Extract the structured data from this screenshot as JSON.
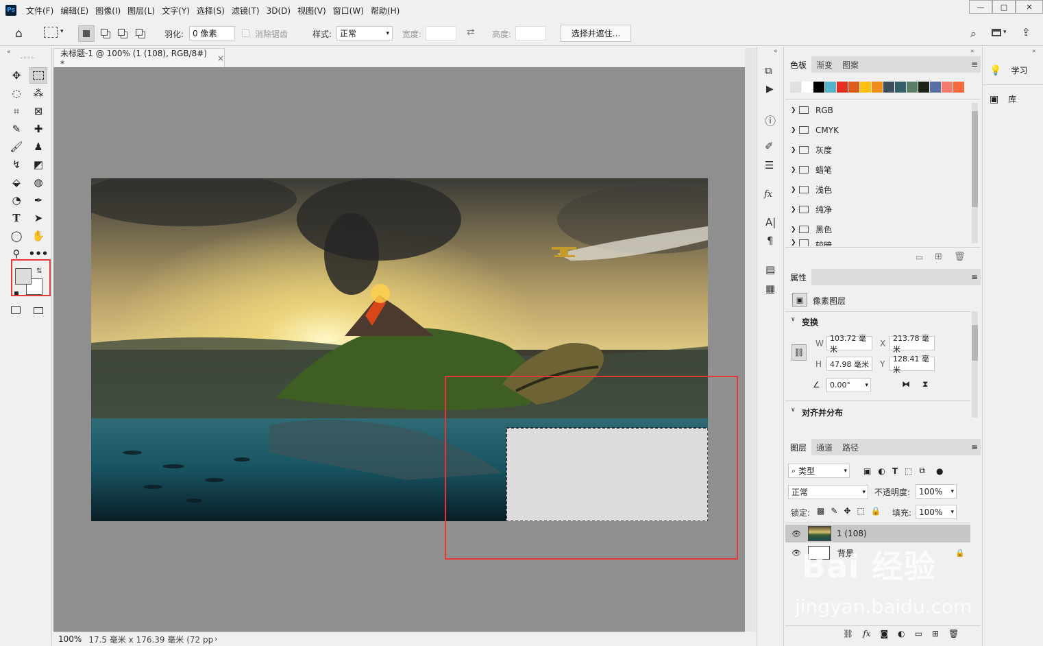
{
  "app_logo": "Ps",
  "menus": [
    "文件(F)",
    "编辑(E)",
    "图像(I)",
    "图层(L)",
    "文字(Y)",
    "选择(S)",
    "滤镜(T)",
    "3D(D)",
    "视图(V)",
    "窗口(W)",
    "帮助(H)"
  ],
  "window_controls": {
    "minimize": "—",
    "maximize": "□",
    "close": "✕"
  },
  "options": {
    "feather_label": "羽化:",
    "feather_value": "0 像素",
    "antialias_label": "消除锯齿",
    "style_label": "样式:",
    "style_value": "正常",
    "width_label": "宽度:",
    "height_label": "高度:",
    "select_mask_button": "选择并遮住..."
  },
  "document": {
    "tab_title": "未标题-1 @ 100% (1 (108), RGB/8#) *",
    "close": "×"
  },
  "status": {
    "zoom": "100%",
    "size": "17.5 毫米 x 176.39 毫米 (72 pp"
  },
  "swatches_panel": {
    "tabs": [
      "色板",
      "渐变",
      "图案"
    ],
    "colors": [
      "#e0e0e0",
      "#ffffff",
      "#000000",
      "#54b2c9",
      "#e6301f",
      "#d95e1b",
      "#fdc012",
      "#f08c1c",
      "#3f4e5c",
      "#345e6a",
      "#5b7e67",
      "#1a2419",
      "#5a6ea6",
      "#f07c6c",
      "#f46a3e"
    ],
    "folders": [
      "RGB",
      "CMYK",
      "灰度",
      "蜡笔",
      "浅色",
      "纯净",
      "黑色",
      "较暗"
    ]
  },
  "properties_panel": {
    "tab": "属性",
    "layer_type": "像素图层",
    "transform_title": "变换",
    "w_label": "W",
    "w_value": "103.72 毫米",
    "x_label": "X",
    "x_value": "213.78 毫米",
    "h_label": "H",
    "h_value": "47.98 毫米",
    "y_label": "Y",
    "y_value": "128.41 毫米",
    "angle_value": "0.00°",
    "align_title": "对齐并分布"
  },
  "layers_panel": {
    "tabs": [
      "图层",
      "通道",
      "路径"
    ],
    "filter_label": "类型",
    "blend_mode": "正常",
    "opacity_label": "不透明度:",
    "opacity_value": "100%",
    "lock_label": "锁定:",
    "fill_label": "填充:",
    "fill_value": "100%",
    "layers": [
      {
        "name": "1 (108)",
        "selected": true
      },
      {
        "name": "背景",
        "locked": true
      }
    ]
  },
  "side_panel": {
    "learn": "学习",
    "library": "库"
  },
  "watermark": {
    "brand": "Bai 经验",
    "url": "jingyan.baidu.com"
  },
  "accent_red": "#e83535"
}
